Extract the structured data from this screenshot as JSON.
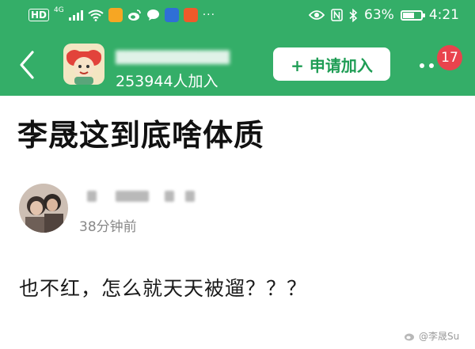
{
  "status_bar": {
    "network_label": "HD",
    "network_gen": "4G",
    "battery_percent": "63%",
    "battery_level": 0.63,
    "time": "4:21"
  },
  "header": {
    "group_name": "▇▇▇▇▇▇▇▇▇▇▇",
    "member_count_text": "253944人加入",
    "join_button_label": "+ 申请加入",
    "notification_count": "17"
  },
  "post": {
    "title": "李晟这到底啥体质",
    "author_name": "▇▇▇▇▇",
    "time_ago": "38分钟前",
    "body": "也不红，怎么就天天被遛？？？"
  },
  "watermark": {
    "text": "@李晟Su"
  },
  "colors": {
    "header_bg": "#34ae68",
    "join_text": "#1f9d55",
    "badge_bg": "#e9434d"
  }
}
